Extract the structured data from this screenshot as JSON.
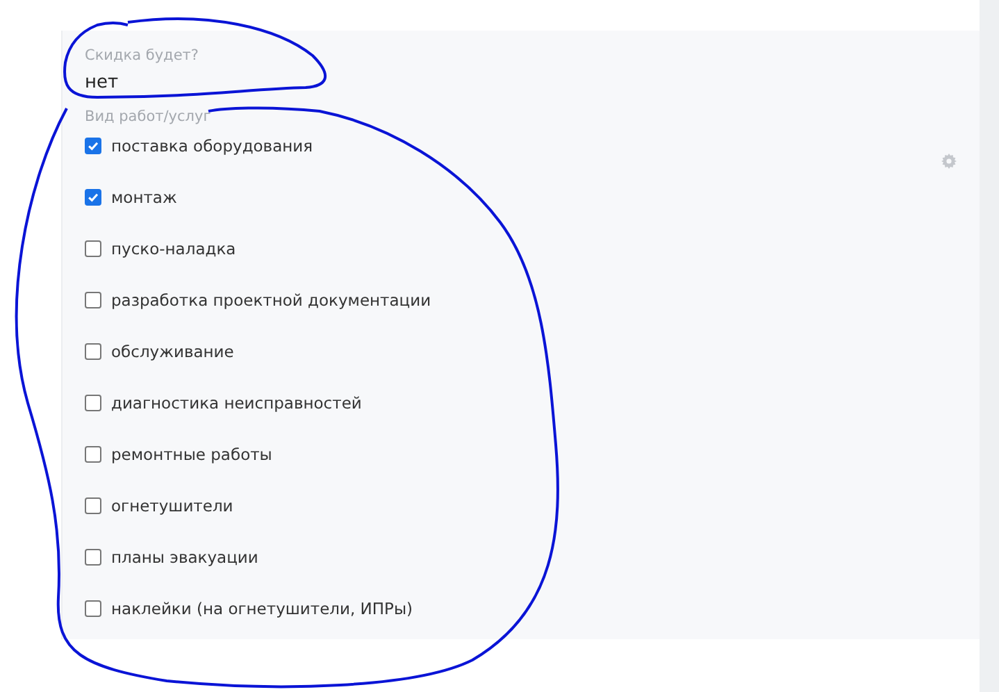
{
  "discount": {
    "label": "Скидка будет?",
    "value": "нет"
  },
  "services": {
    "label": "Вид работ/услуг",
    "items": [
      {
        "label": "поставка оборудования",
        "checked": true
      },
      {
        "label": "монтаж",
        "checked": true
      },
      {
        "label": "пуско-наладка",
        "checked": false
      },
      {
        "label": "разработка проектной документации",
        "checked": false
      },
      {
        "label": "обслуживание",
        "checked": false
      },
      {
        "label": "диагностика неисправностей",
        "checked": false
      },
      {
        "label": "ремонтные работы",
        "checked": false
      },
      {
        "label": "огнетушители",
        "checked": false
      },
      {
        "label": "планы эвакуации",
        "checked": false
      },
      {
        "label": "наклейки (на огнетушители, ИПРы)",
        "checked": false
      }
    ]
  }
}
